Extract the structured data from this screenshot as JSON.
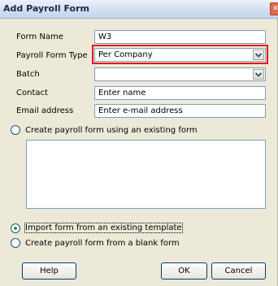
{
  "dialog": {
    "title": "Add Payroll Form"
  },
  "form": {
    "form_name_label": "Form Name",
    "form_name_value": "W3",
    "payroll_form_type_label": "Payroll Form Type",
    "payroll_form_type_value": "Per Company",
    "batch_label": "Batch",
    "batch_value": "",
    "contact_label": "Contact",
    "contact_value": "Enter name",
    "email_label": "Email address",
    "email_value": "Enter e-mail address"
  },
  "options": {
    "existing_form_label": "Create payroll form using an existing form",
    "existing_form_selected": false,
    "import_template_label": "Import form from an existing template",
    "import_template_selected": true,
    "blank_form_label": "Create payroll form from a blank form",
    "blank_form_selected": false
  },
  "buttons": {
    "help": "Help",
    "ok": "OK",
    "cancel": "Cancel"
  },
  "colors": {
    "highlight": "#e0161e",
    "radio_dot": "#21a121"
  }
}
